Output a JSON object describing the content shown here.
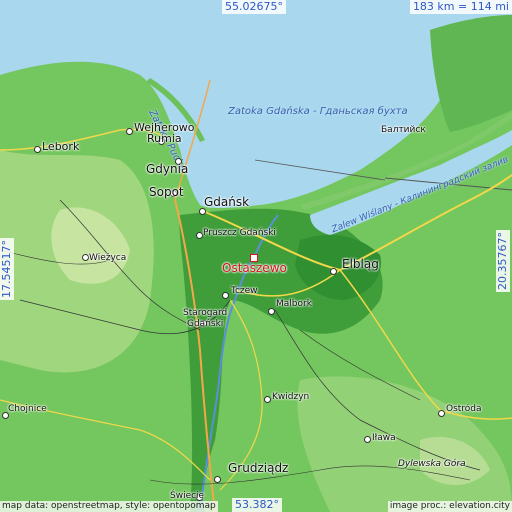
{
  "map": {
    "coords": {
      "top": "55.02675°",
      "bottom": "53.382°",
      "left": "17.54517°",
      "right": "20.35767°"
    },
    "scale": "183 km = 114 mi",
    "attribution": {
      "left": "map data: openstreetmap, style: opentopomap",
      "right": "image proc.: elevation.city"
    },
    "highlight": "Ostaszewo",
    "places": {
      "lebork": "Lebork",
      "wejherowo": "Wejherowo",
      "rumia": "Rumia",
      "gdynia": "Gdynia",
      "sopot": "Sopot",
      "gdansk": "Gdańsk",
      "pruszcz": "Pruszcz Gdański",
      "wiezyca": "Wieżyca",
      "tczew": "Tczew",
      "starogard_1": "Starogard",
      "starogard_2": "Gdański",
      "malbork": "Malbork",
      "elblag": "Elbląg",
      "baltiysk": "Балтийск",
      "kwidzyn": "Kwidzyn",
      "chojnice": "Chojnice",
      "ilawa": "Iława",
      "ostroda": "Ostróda",
      "grudziadz": "Grudziądz",
      "swiecie": "Świecie",
      "dylewska": "Dylewska Góra"
    },
    "water": {
      "puck_bay": "Zatoka Pucka",
      "gdansk_bay": "Zatoka Gdańska - Гданьская бухта",
      "vistula_lagoon": "Zalew Wiślany - Калининградский залив"
    }
  }
}
